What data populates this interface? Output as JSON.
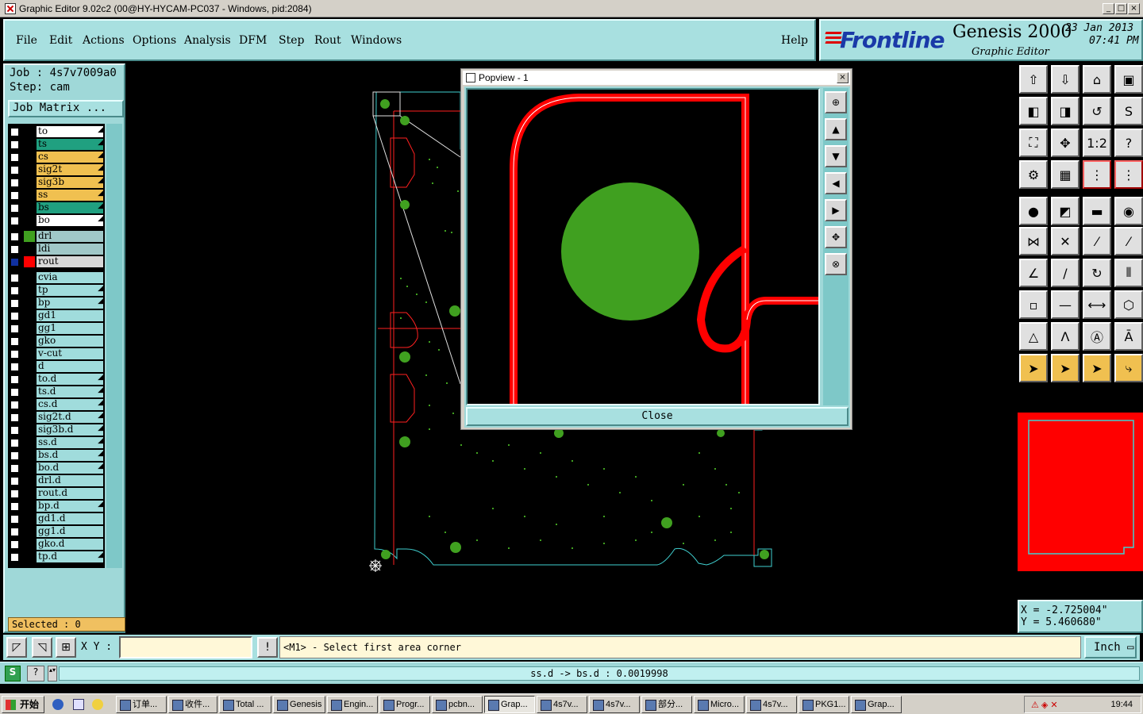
{
  "window": {
    "title": "Graphic Editor 9.02c2 (00@HY-HYCAM-PC037 - Windows, pid:2084)"
  },
  "menu": {
    "items": [
      "File",
      "Edit",
      "Actions",
      "Options",
      "Analysis",
      "DFM",
      "Step",
      "Rout",
      "Windows"
    ],
    "help": "Help"
  },
  "brand": {
    "logo": "Frontline",
    "product": "Genesis 2000",
    "subtitle": "Graphic Editor",
    "date": "23 Jan 2013",
    "time": "07:41 PM"
  },
  "job": {
    "job_line": "Job : 4s7v7009a0",
    "step_line": "Step: cam",
    "matrix_button": "Job Matrix ..."
  },
  "layers": [
    {
      "name": "to",
      "color": "#ffffff",
      "mark": true
    },
    {
      "name": "ts",
      "color": "#20a080",
      "mark": true
    },
    {
      "name": "cs",
      "color": "#f0c050",
      "mark": true
    },
    {
      "name": "sig2t",
      "color": "#f0c050",
      "mark": true
    },
    {
      "name": "sig3b",
      "color": "#f0c050",
      "mark": true
    },
    {
      "name": "ss",
      "color": "#f0c050",
      "mark": true
    },
    {
      "name": "bs",
      "color": "#20a080",
      "mark": true
    },
    {
      "name": "bo",
      "color": "#ffffff",
      "mark": true
    },
    {
      "name": "drl",
      "color": "#a0c8c8",
      "swatch": "#40a020",
      "mark": false
    },
    {
      "name": "ldi",
      "color": "#a0c8c8",
      "mark": false
    },
    {
      "name": "rout",
      "color": "#d8d8d8",
      "swatch": "#ff0000",
      "mark": false
    },
    {
      "name": "cvia",
      "color": "#a0dcdc",
      "mark": false
    },
    {
      "name": "tp",
      "color": "#a0dcdc",
      "mark": true
    },
    {
      "name": "bp",
      "color": "#a0dcdc",
      "mark": true
    },
    {
      "name": "gd1",
      "color": "#a0dcdc",
      "mark": false
    },
    {
      "name": "gg1",
      "color": "#a0dcdc",
      "mark": false
    },
    {
      "name": "gko",
      "color": "#a0dcdc",
      "mark": false
    },
    {
      "name": "v-cut",
      "color": "#a0dcdc",
      "mark": false
    },
    {
      "name": "d",
      "color": "#a0dcdc",
      "mark": false
    },
    {
      "name": "to.d",
      "color": "#a0dcdc",
      "mark": true
    },
    {
      "name": "ts.d",
      "color": "#a0dcdc",
      "mark": true
    },
    {
      "name": "cs.d",
      "color": "#a0dcdc",
      "mark": true
    },
    {
      "name": "sig2t.d",
      "color": "#a0dcdc",
      "mark": true
    },
    {
      "name": "sig3b.d",
      "color": "#a0dcdc",
      "mark": true
    },
    {
      "name": "ss.d",
      "color": "#a0dcdc",
      "mark": true
    },
    {
      "name": "bs.d",
      "color": "#a0dcdc",
      "mark": true
    },
    {
      "name": "bo.d",
      "color": "#a0dcdc",
      "mark": true
    },
    {
      "name": "drl.d",
      "color": "#a0dcdc",
      "mark": false
    },
    {
      "name": "rout.d",
      "color": "#a0dcdc",
      "mark": false
    },
    {
      "name": "bp.d",
      "color": "#a0dcdc",
      "mark": true
    },
    {
      "name": "gd1.d",
      "color": "#a0dcdc",
      "mark": false
    },
    {
      "name": "gg1.d",
      "color": "#a0dcdc",
      "mark": false
    },
    {
      "name": "gko.d",
      "color": "#a0dcdc",
      "mark": false
    },
    {
      "name": "tp.d",
      "color": "#a0dcdc",
      "mark": true
    }
  ],
  "selected": "Selected : 0",
  "popview": {
    "title": "Popview - 1",
    "close_label": "Close"
  },
  "coords": {
    "x": "X = -2.725004\"",
    "y": "Y = 5.460680\""
  },
  "command": {
    "xy_label": "X Y :",
    "xy_value": "",
    "prompt": "<M1> - Select first area corner",
    "unit": "Inch"
  },
  "status": {
    "text": "ss.d -> bs.d : 0.0019998"
  },
  "taskbar": {
    "start": "开始",
    "tasks": [
      "订单...",
      "收件...",
      "Total ...",
      "Genesis",
      "Engin...",
      "Progr...",
      "pcbn...",
      "Grap...",
      "4s7v...",
      "4s7v...",
      "部分...",
      "Micro...",
      "4s7v...",
      "PKG1...",
      "Grap..."
    ],
    "clock": "19:44"
  }
}
